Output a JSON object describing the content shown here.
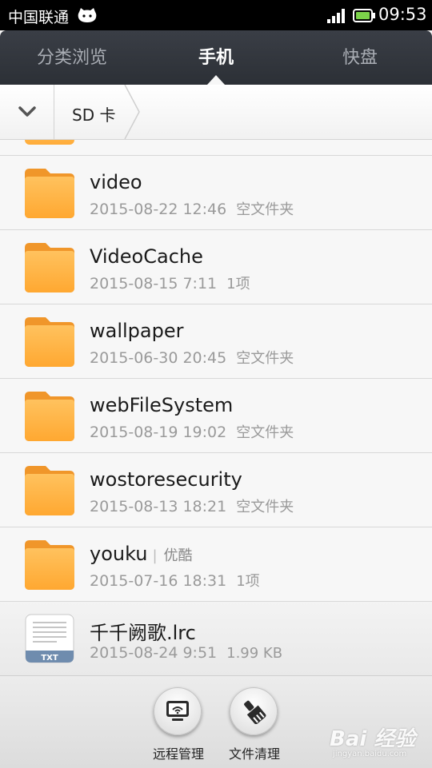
{
  "status_bar": {
    "carrier": "中国联通",
    "time": "09:53",
    "icons": [
      "cat-notification-icon",
      "signal-icon",
      "battery-icon"
    ]
  },
  "tabs": [
    {
      "label": "分类浏览",
      "active": false
    },
    {
      "label": "手机",
      "active": true
    },
    {
      "label": "快盘",
      "active": false
    }
  ],
  "path": {
    "back_icon": "chevron-down-icon",
    "crumb": "SD 卡"
  },
  "files": [
    {
      "name": "video",
      "alias": "",
      "date": "2015-08-22 12:46",
      "info": "空文件夹",
      "type": "folder"
    },
    {
      "name": "VideoCache",
      "alias": "",
      "date": "2015-08-15 7:11",
      "info": "1项",
      "type": "folder"
    },
    {
      "name": "wallpaper",
      "alias": "",
      "date": "2015-06-30 20:45",
      "info": "空文件夹",
      "type": "folder"
    },
    {
      "name": "webFileSystem",
      "alias": "",
      "date": "2015-08-19 19:02",
      "info": "空文件夹",
      "type": "folder"
    },
    {
      "name": "wostoresecurity",
      "alias": "",
      "date": "2015-08-13 18:21",
      "info": "空文件夹",
      "type": "folder"
    },
    {
      "name": "youku",
      "alias": "优酷",
      "date": "2015-07-16 18:31",
      "info": "1项",
      "type": "folder"
    },
    {
      "name": "千千阙歌.lrc",
      "alias": "",
      "date": "2015-08-24 9:51",
      "info": "1.99 KB",
      "type": "txt",
      "badge": "TXT"
    }
  ],
  "actions": [
    {
      "label": "远程管理",
      "icon": "remote-manage-icon"
    },
    {
      "label": "文件清理",
      "icon": "cleanup-brush-icon"
    }
  ],
  "watermark": {
    "main": "Bai 经验",
    "sub": "jingyan.baidu.com"
  },
  "colors": {
    "tabbar": "#2c3036",
    "folder": "#ffab38",
    "meta_text": "#9a9a9a"
  }
}
